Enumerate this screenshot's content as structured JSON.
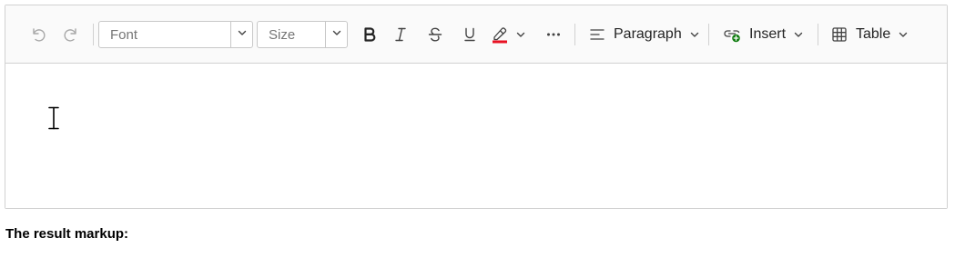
{
  "toolbar": {
    "font_placeholder": "Font",
    "size_placeholder": "Size",
    "paragraph_label": "Paragraph",
    "insert_label": "Insert",
    "table_label": "Table",
    "highlight_color": "#e81123"
  },
  "footer": {
    "result_label": "The result markup:"
  }
}
